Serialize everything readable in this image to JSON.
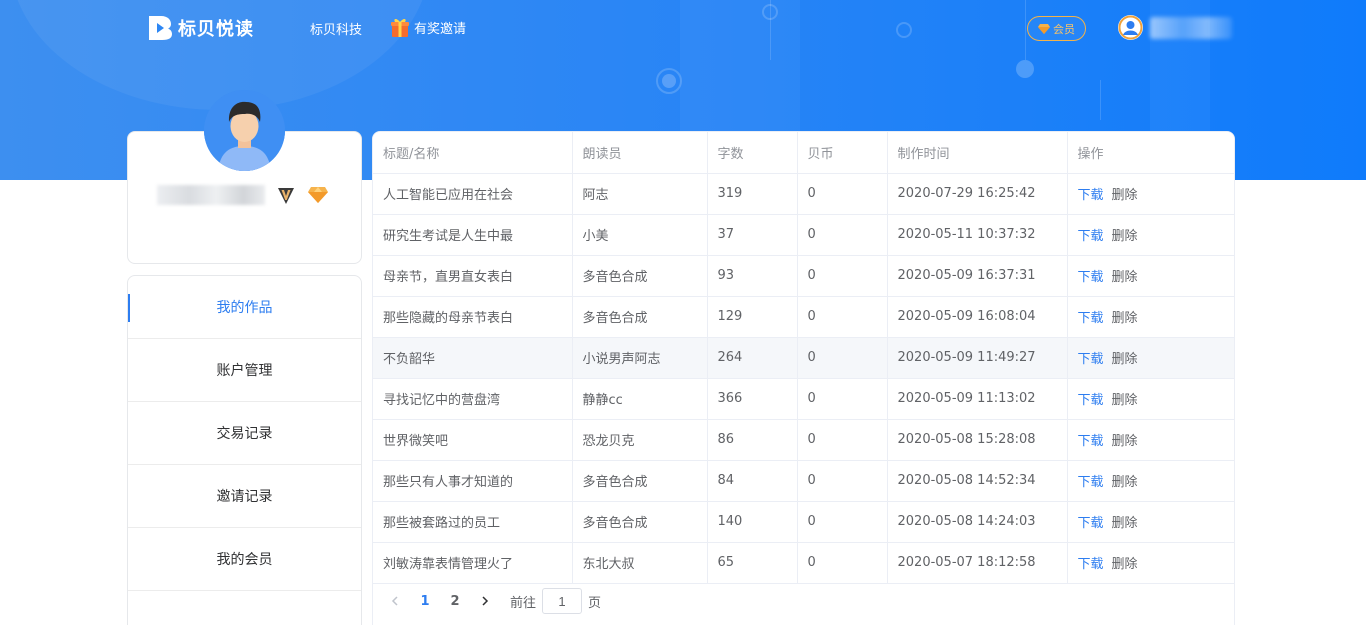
{
  "header": {
    "logo_text": "标贝悦读",
    "nav_company": "标贝科技",
    "nav_invite": "有奖邀请",
    "member_label": "会员",
    "colors": {
      "primary": "#2d7df0",
      "gold": "#f3b34a",
      "hero_start": "#3d8ff0",
      "hero_end": "#0f7bfb"
    }
  },
  "profile": {
    "avatar_icon": "user-avatar-icon",
    "badges": [
      "vip-v-icon",
      "diamond-icon"
    ]
  },
  "menu": {
    "items": [
      {
        "label": "我的作品",
        "active": true
      },
      {
        "label": "账户管理"
      },
      {
        "label": "交易记录"
      },
      {
        "label": "邀请记录"
      },
      {
        "label": "我的会员"
      }
    ]
  },
  "table": {
    "columns": [
      "标题/名称",
      "朗读员",
      "字数",
      "贝币",
      "制作时间",
      "操作"
    ],
    "action_download": "下载",
    "action_delete": "删除",
    "rows": [
      {
        "title": "人工智能已应用在社会",
        "reader": "阿志",
        "words": "319",
        "coins": "0",
        "time": "2020-07-29 16:25:42"
      },
      {
        "title": "研究生考试是人生中最",
        "reader": "小美",
        "words": "37",
        "coins": "0",
        "time": "2020-05-11 10:37:32"
      },
      {
        "title": "母亲节，直男直女表白",
        "reader": "多音色合成",
        "words": "93",
        "coins": "0",
        "time": "2020-05-09 16:37:31"
      },
      {
        "title": "那些隐藏的母亲节表白",
        "reader": "多音色合成",
        "words": "129",
        "coins": "0",
        "time": "2020-05-09 16:08:04"
      },
      {
        "title": "不负韶华",
        "reader": "小说男声阿志",
        "words": "264",
        "coins": "0",
        "time": "2020-05-09 11:49:27"
      },
      {
        "title": "寻找记忆中的营盘湾",
        "reader": "静静cc",
        "words": "366",
        "coins": "0",
        "time": "2020-05-09 11:13:02"
      },
      {
        "title": "世界微笑吧",
        "reader": "恐龙贝克",
        "words": "86",
        "coins": "0",
        "time": "2020-05-08 15:28:08"
      },
      {
        "title": "那些只有人事才知道的",
        "reader": "多音色合成",
        "words": "84",
        "coins": "0",
        "time": "2020-05-08 14:52:34"
      },
      {
        "title": "那些被套路过的员工",
        "reader": "多音色合成",
        "words": "140",
        "coins": "0",
        "time": "2020-05-08 14:24:03"
      },
      {
        "title": "刘敏涛靠表情管理火了",
        "reader": "东北大叔",
        "words": "65",
        "coins": "0",
        "time": "2020-05-07 18:12:58"
      }
    ]
  },
  "pagination": {
    "pages": [
      "1",
      "2"
    ],
    "current": "1",
    "goto_prefix": "前往",
    "goto_value": "1",
    "goto_suffix": "页"
  }
}
